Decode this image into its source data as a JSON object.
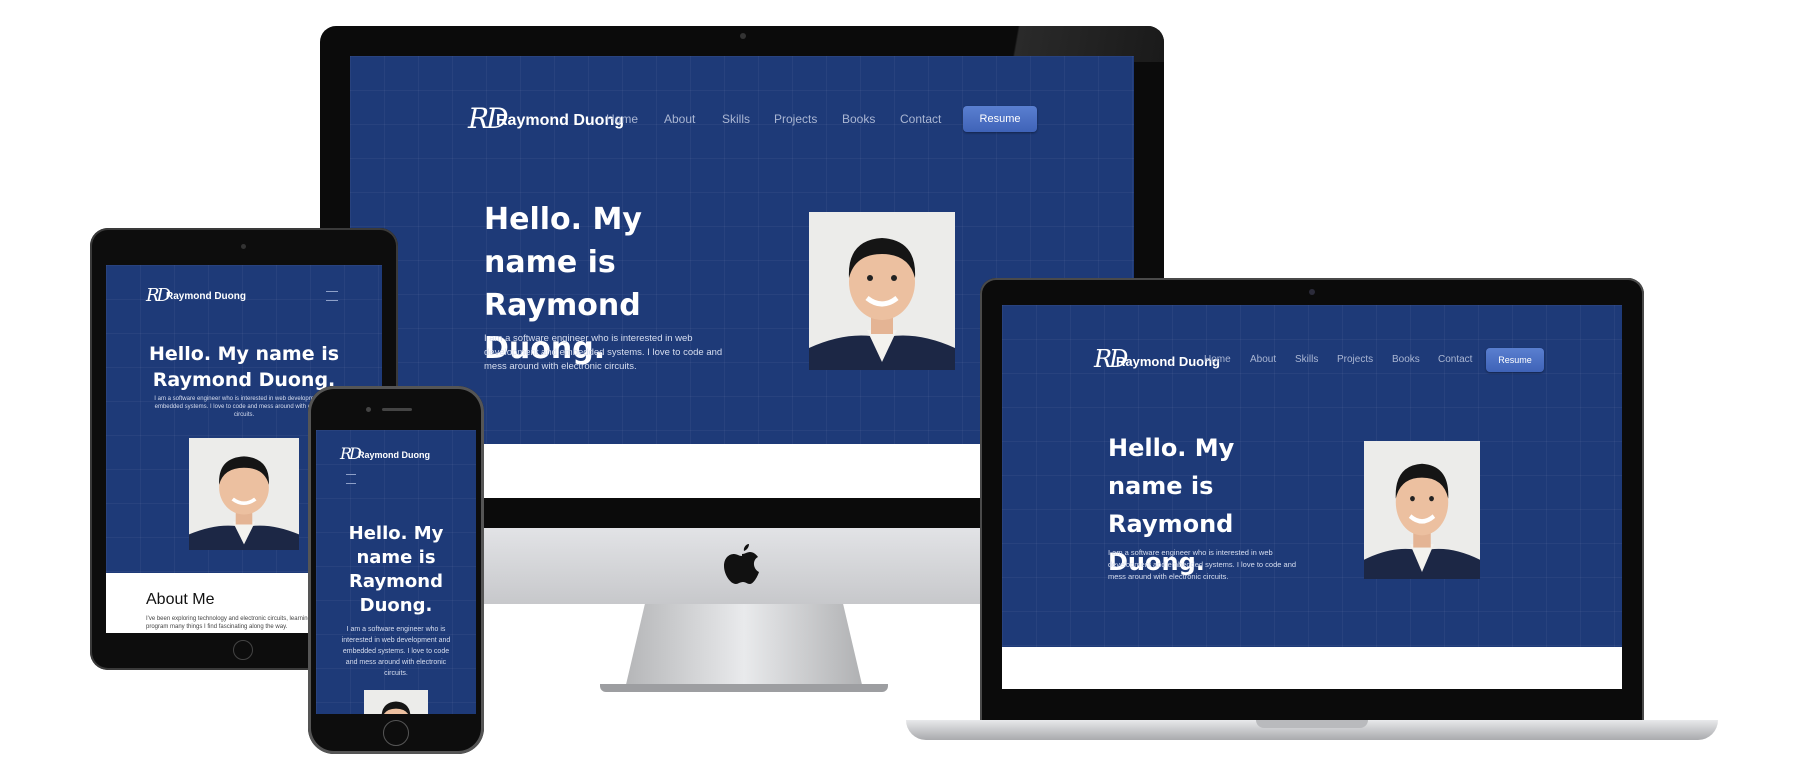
{
  "site": {
    "logo_initials": "RD",
    "brand": "Raymond Duong",
    "nav": [
      "Home",
      "About",
      "Skills",
      "Projects",
      "Books",
      "Contact"
    ],
    "resume_label": "Resume",
    "hero_title": "Hello. My name is Raymond Duong.",
    "hero_text": "I am a software engineer who is interested in web development and embedded systems. I love to code and mess around with electronic circuits.",
    "about_heading": "About Me",
    "about_snippet": "I've been exploring technology and electronic circuits, learning to build and program many things I find fascinating along the way."
  },
  "colors": {
    "hero_bg": "#1e3a78",
    "button": "#4a6fc4",
    "device_black": "#0c0c0c",
    "stand_silver": "#c9cacc"
  },
  "icons": {
    "apple_logo": "apple-icon",
    "menu": "hamburger-menu-icon"
  }
}
